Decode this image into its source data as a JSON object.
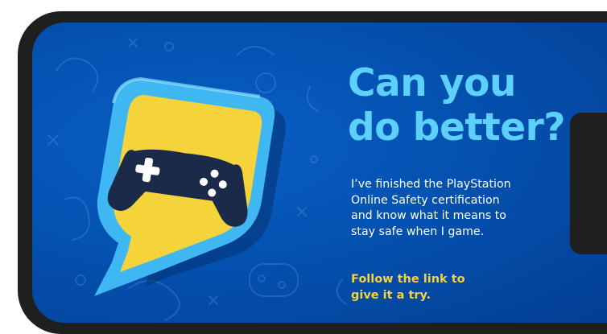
{
  "headline": {
    "line1": "Can you",
    "line2": "do better?"
  },
  "message": {
    "lines": [
      "I’ve finished the PlayStation",
      "Online Safety certification",
      "and know what it means to",
      "stay safe when I game."
    ]
  },
  "cta": {
    "lines": [
      "Follow the link to",
      "give it a try."
    ]
  },
  "badge": {
    "icon": "gamepad-icon",
    "shape": "shield-speech-bubble"
  },
  "colors": {
    "frame": "#1f1f1f",
    "screen": "#0453b3",
    "headline": "#5cd0ff",
    "body_text": "#ffffff",
    "cta": "#f5d33a",
    "shield_outer": "#3fb7f2",
    "shield_inner": "#f5d33a",
    "gamepad": "#1c2a4a"
  }
}
